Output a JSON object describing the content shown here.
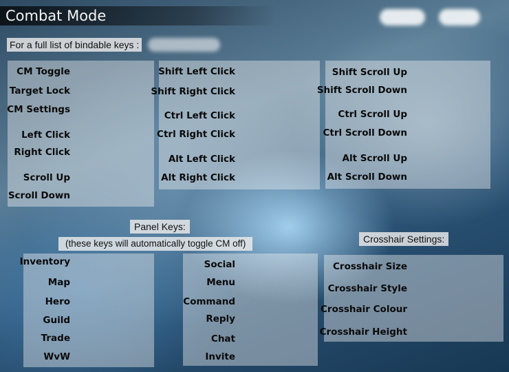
{
  "header": {
    "title": "Combat Mode"
  },
  "bindable_note": "For a full list of bindable keys :",
  "core_panel": {
    "items": [
      "CM Toggle",
      "Target Lock",
      "CM Settings",
      "Left Click",
      "Right Click",
      "Scroll Up",
      "Scroll Down"
    ]
  },
  "modifier_click_panel": {
    "items": [
      "Shift Left Click",
      "Shift Right Click",
      "Ctrl Left Click",
      "Ctrl Right Click",
      "Alt Left Click",
      "Alt Right Click"
    ]
  },
  "modifier_scroll_panel": {
    "items": [
      "Shift Scroll Up",
      "Shift Scroll Down",
      "Ctrl Scroll Up",
      "Ctrl Scroll Down",
      "Alt Scroll Up",
      "Alt Scroll Down"
    ]
  },
  "panel_keys": {
    "label": "Panel Keys:",
    "note": "(these keys will automatically toggle CM off)",
    "left_items": [
      "Inventory",
      "Map",
      "Hero",
      "Guild",
      "Trade",
      "WvW"
    ],
    "right_items": [
      "Social",
      "Menu",
      "Command",
      "Reply",
      "Chat",
      "Invite"
    ]
  },
  "crosshair": {
    "label": "Crosshair Settings:",
    "items": [
      "Crosshair Size",
      "Crosshair Style",
      "Crosshair Colour",
      "Crosshair Height"
    ]
  }
}
